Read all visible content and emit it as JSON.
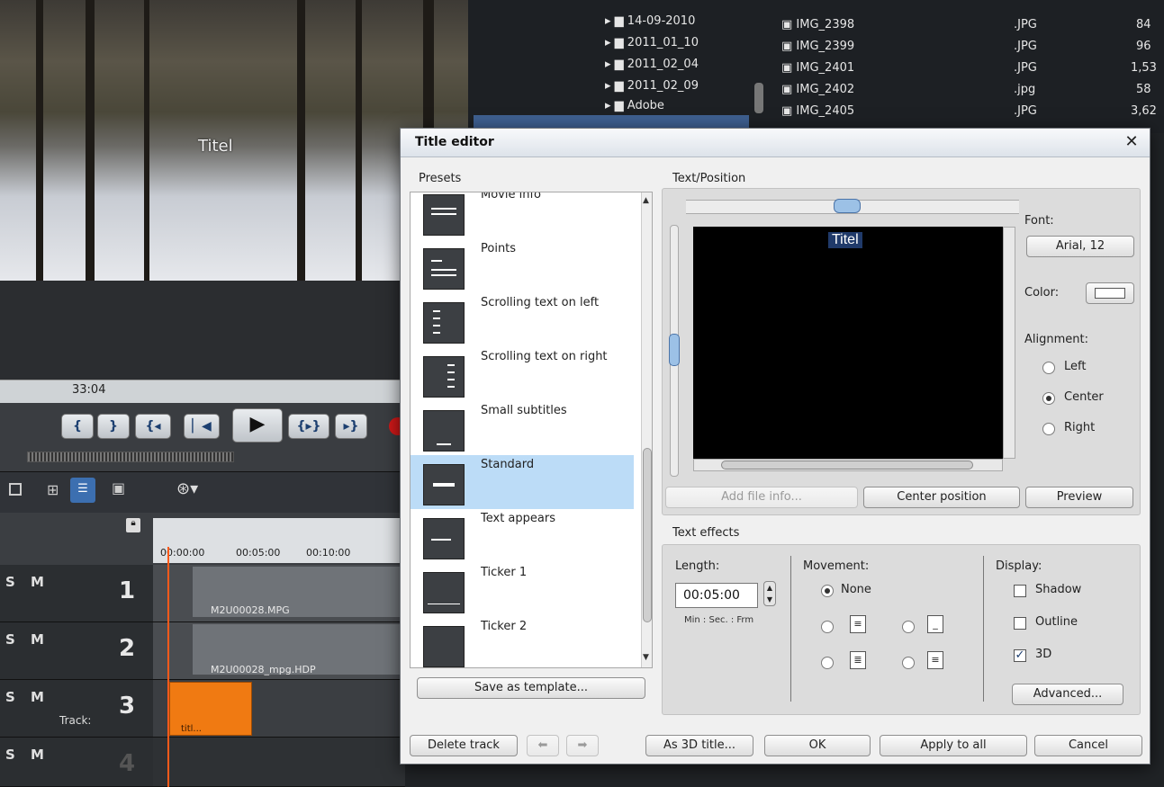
{
  "preview": {
    "title_overlay": "Titel",
    "timecode": "33:04"
  },
  "file_browser": {
    "folders": [
      "14-09-2010",
      "2011_01_10",
      "2011_02_04",
      "2011_02_09",
      "Adobe"
    ],
    "files": [
      {
        "name": "IMG_2398",
        "ext": ".JPG",
        "size": "84"
      },
      {
        "name": "IMG_2399",
        "ext": ".JPG",
        "size": "96"
      },
      {
        "name": "IMG_2401",
        "ext": ".JPG",
        "size": "1,53"
      },
      {
        "name": "IMG_2402",
        "ext": ".jpg",
        "size": "58"
      },
      {
        "name": "IMG_2405",
        "ext": ".JPG",
        "size": "3,62"
      }
    ]
  },
  "timeline": {
    "ruler": [
      "00:00:00",
      "00:05:00",
      "00:10:00"
    ],
    "tracks": [
      {
        "number": "1",
        "clip": "M2U00028.MPG"
      },
      {
        "number": "2",
        "clip": "M2U00028_mpg.HDP"
      },
      {
        "number": "3",
        "label": "Track:",
        "clip": "titl..."
      },
      {
        "number": "4"
      }
    ],
    "track_controls": "S M"
  },
  "dialog": {
    "title": "Title editor",
    "presets_label": "Presets",
    "presets": [
      "Movie info",
      "Points",
      "Scrolling text on left",
      "Scrolling text on right",
      "Small subtitles",
      "Standard",
      "Text appears",
      "Ticker 1",
      "Ticker 2"
    ],
    "selected_preset": "Standard",
    "save_template": "Save as template...",
    "text_position_label": "Text/Position",
    "canvas_text": "Titel",
    "font_label": "Font:",
    "font_value": "Arial, 12",
    "color_label": "Color:",
    "alignment_label": "Alignment:",
    "alignment_options": [
      "Left",
      "Center",
      "Right"
    ],
    "alignment_selected": "Center",
    "add_file_info": "Add file info...",
    "center_position": "Center position",
    "preview": "Preview",
    "text_effects_label": "Text effects",
    "length_label": "Length:",
    "length_value": "00:05:00",
    "length_units": "Min : Sec. : Frm",
    "movement_label": "Movement:",
    "movement_none": "None",
    "display_label": "Display:",
    "display_shadow": "Shadow",
    "display_outline": "Outline",
    "display_3d": "3D",
    "advanced": "Advanced...",
    "delete_track": "Delete track",
    "as_3d_title": "As 3D title...",
    "ok": "OK",
    "apply_to_all": "Apply to all",
    "cancel": "Cancel"
  }
}
